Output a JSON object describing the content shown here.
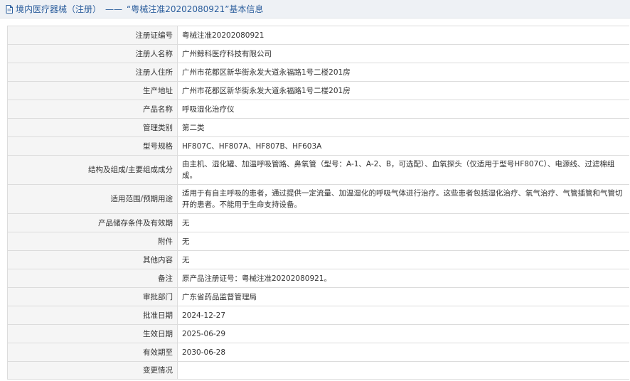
{
  "header": {
    "category": "境内医疗器械（注册）",
    "separator": "——",
    "title": "“粤械注准20202080921”基本信息"
  },
  "rows": [
    {
      "label": "注册证编号",
      "value": "粤械注准20202080921"
    },
    {
      "label": "注册人名称",
      "value": "广州鲸科医疗科技有限公司"
    },
    {
      "label": "注册人住所",
      "value": "广州市花都区新华街永发大道永福路1号二楼201房"
    },
    {
      "label": "生产地址",
      "value": "广州市花都区新华街永发大道永福路1号二楼201房"
    },
    {
      "label": "产品名称",
      "value": "呼吸湿化治疗仪"
    },
    {
      "label": "管理类别",
      "value": "第二类"
    },
    {
      "label": "型号规格",
      "value": "HF807C、HF807A、HF807B、HF603A"
    },
    {
      "label": "结构及组成/主要组成成分",
      "value": "由主机、湿化罐、加温呼吸管路、鼻氧管（型号：A-1、A-2、B，可选配）、血氧探头（仅适用于型号HF807C）、电源线、过滤棉组成。"
    },
    {
      "label": "适用范围/预期用途",
      "value": "适用于有自主呼吸的患者，通过提供一定流量、加温湿化的呼吸气体进行治疗。这些患者包括湿化治疗、氧气治疗、气管插管和气管切开的患者。不能用于生命支持设备。"
    },
    {
      "label": "产品储存条件及有效期",
      "value": "无"
    },
    {
      "label": "附件",
      "value": "无"
    },
    {
      "label": "其他内容",
      "value": "无"
    },
    {
      "label": "备注",
      "value": "原产品注册证号：粤械注准20202080921。"
    },
    {
      "label": "审批部门",
      "value": "广东省药品监督管理局"
    },
    {
      "label": "批准日期",
      "value": "2024-12-27"
    },
    {
      "label": "生效日期",
      "value": "2025-06-29"
    },
    {
      "label": "有效期至",
      "value": "2030-06-28"
    },
    {
      "label": "变更情况",
      "value": ""
    }
  ]
}
